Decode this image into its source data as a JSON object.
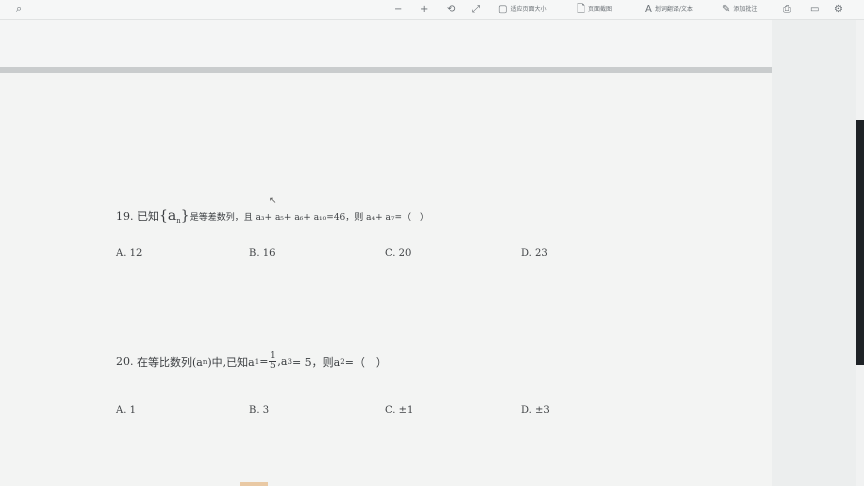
{
  "toolbar": {
    "buttons": [
      {
        "icon": "minus-icon",
        "glyph": "−"
      },
      {
        "icon": "plus-icon",
        "glyph": "+"
      },
      {
        "icon": "rotate-icon",
        "glyph": "⟲"
      },
      {
        "icon": "expand-icon",
        "glyph": "⤢"
      },
      {
        "icon": "fit-page-icon",
        "glyph": "▢",
        "label": "适应页面大小"
      },
      {
        "icon": "doc-icon",
        "glyph": "🗋",
        "label": "页面截图"
      },
      {
        "icon": "text-icon",
        "glyph": "A",
        "label": "划词翻译/文本"
      },
      {
        "icon": "pen-icon",
        "glyph": "✎",
        "label": "添加批注"
      },
      {
        "icon": "print-icon",
        "glyph": "⎙"
      },
      {
        "icon": "save-icon",
        "glyph": "▭"
      },
      {
        "icon": "settings-icon",
        "glyph": "⚙"
      }
    ]
  },
  "q19": {
    "number": "19.",
    "text_a": "已知",
    "seq": "{a",
    "seq_sub": "n",
    "seq_end": "}",
    "text_b": "是等差数列，且 a₃+ a₅+ a₆+ a₁₀=46，则 a₄+ a₇=（　）",
    "options": [
      "A. 12",
      "B. 16",
      "C. 20",
      "D. 23"
    ]
  },
  "q20": {
    "number": "20.",
    "text_a": "在等比数列(a",
    "sub_n": "n",
    "text_b": ")中,已知a",
    "sub_1": "1",
    "eq": "=",
    "frac_num": "1",
    "frac_den": "5",
    "text_c": ",a",
    "sub_3": "3",
    "text_d": "= 5，则a",
    "sub_2": "2",
    "text_e": "=（　）",
    "options": [
      "A. 1",
      "B. 3",
      "C. ±1",
      "D. ±3"
    ]
  }
}
